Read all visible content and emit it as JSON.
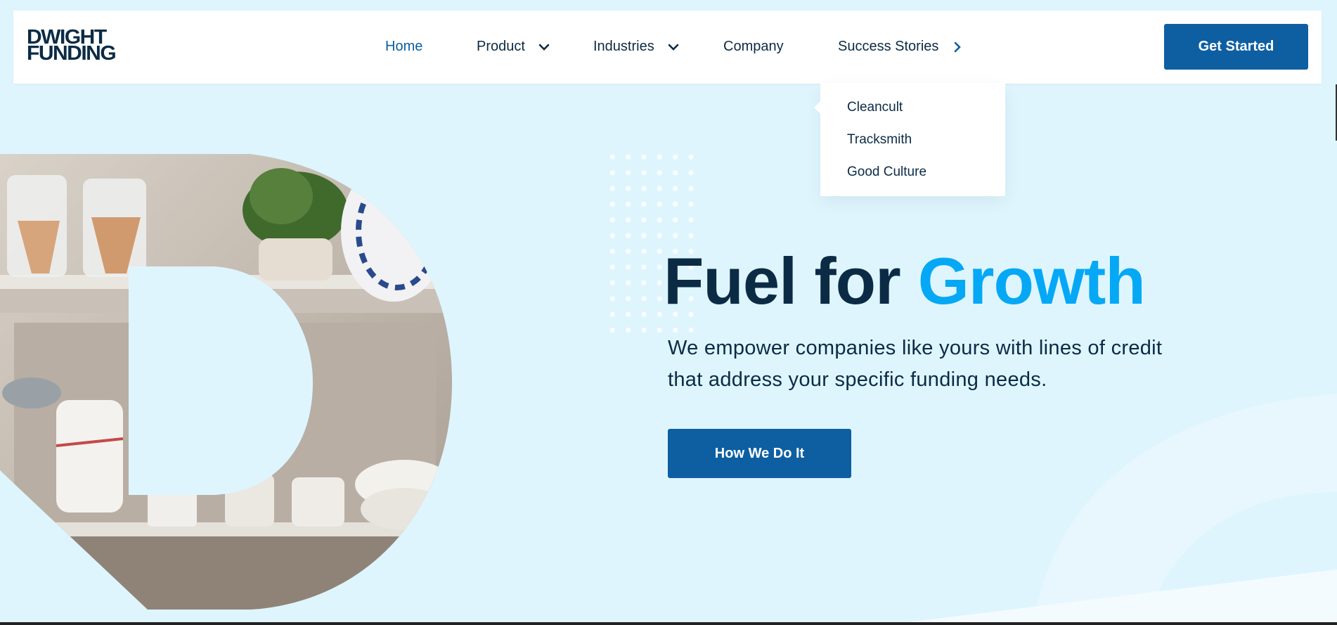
{
  "colors": {
    "page_background": "#def5fe",
    "brand_navy": "#0b2b45",
    "brand_blue": "#0d5fa1",
    "accent_cyan": "#05a8f5",
    "header_background": "#ffffff"
  },
  "header": {
    "logo_line1": "DWIGHT",
    "logo_line2": "FUNDING",
    "nav": [
      {
        "label": "Home",
        "active": true
      },
      {
        "label": "Product",
        "icon": "chevron-down-icon"
      },
      {
        "label": "Industries",
        "icon": "chevron-down-icon"
      },
      {
        "label": "Company"
      },
      {
        "label": "Success Stories",
        "icon": "chevron-right-icon"
      }
    ],
    "cta_label": "Get Started"
  },
  "dropdown": {
    "items": [
      "Cleancult",
      "Tracksmith",
      "Good Culture"
    ]
  },
  "hero": {
    "headline_part1": "Fuel for ",
    "headline_accent": "Growth",
    "subtext": "We empower companies like yours with lines of credit that address your specific funding needs.",
    "cta_label": "How We Do It"
  }
}
